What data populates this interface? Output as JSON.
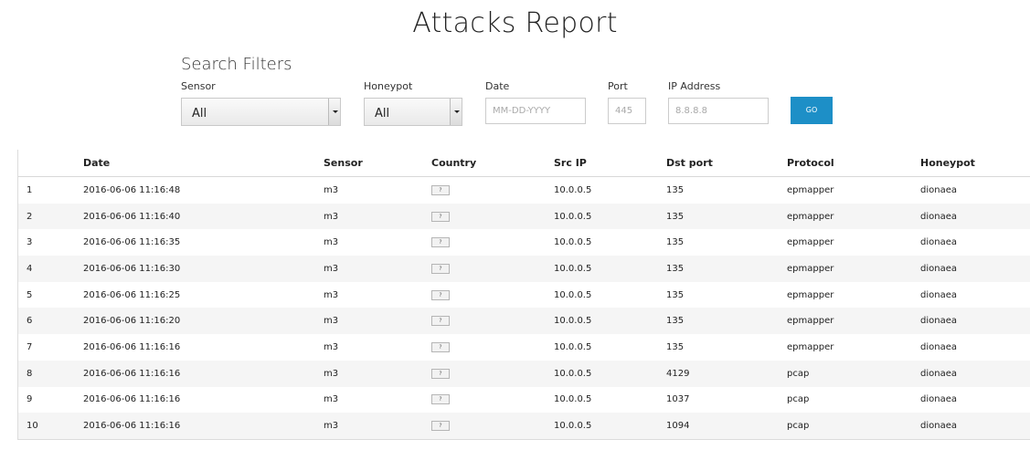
{
  "page": {
    "title": "Attacks Report"
  },
  "filters": {
    "title": "Search Filters",
    "sensor": {
      "label": "Sensor",
      "value": "All"
    },
    "honeypot": {
      "label": "Honeypot",
      "value": "All"
    },
    "date": {
      "label": "Date",
      "placeholder": "MM-DD-YYYY"
    },
    "port": {
      "label": "Port",
      "placeholder": "445"
    },
    "ip": {
      "label": "IP Address",
      "placeholder": "8.8.8.8"
    },
    "go_label": "GO",
    "go_color": "#1d8fc7"
  },
  "table": {
    "headers": [
      "",
      "Date",
      "Sensor",
      "Country",
      "Src IP",
      "Dst port",
      "Protocol",
      "Honeypot"
    ],
    "rows": [
      [
        "1",
        "2016-06-06 11:16:48",
        "m3",
        "?",
        "10.0.0.5",
        "135",
        "epmapper",
        "dionaea"
      ],
      [
        "2",
        "2016-06-06 11:16:40",
        "m3",
        "?",
        "10.0.0.5",
        "135",
        "epmapper",
        "dionaea"
      ],
      [
        "3",
        "2016-06-06 11:16:35",
        "m3",
        "?",
        "10.0.0.5",
        "135",
        "epmapper",
        "dionaea"
      ],
      [
        "4",
        "2016-06-06 11:16:30",
        "m3",
        "?",
        "10.0.0.5",
        "135",
        "epmapper",
        "dionaea"
      ],
      [
        "5",
        "2016-06-06 11:16:25",
        "m3",
        "?",
        "10.0.0.5",
        "135",
        "epmapper",
        "dionaea"
      ],
      [
        "6",
        "2016-06-06 11:16:20",
        "m3",
        "?",
        "10.0.0.5",
        "135",
        "epmapper",
        "dionaea"
      ],
      [
        "7",
        "2016-06-06 11:16:16",
        "m3",
        "?",
        "10.0.0.5",
        "135",
        "epmapper",
        "dionaea"
      ],
      [
        "8",
        "2016-06-06 11:16:16",
        "m3",
        "?",
        "10.0.0.5",
        "4129",
        "pcap",
        "dionaea"
      ],
      [
        "9",
        "2016-06-06 11:16:16",
        "m3",
        "?",
        "10.0.0.5",
        "1037",
        "pcap",
        "dionaea"
      ],
      [
        "10",
        "2016-06-06 11:16:16",
        "m3",
        "?",
        "10.0.0.5",
        "1094",
        "pcap",
        "dionaea"
      ]
    ]
  }
}
